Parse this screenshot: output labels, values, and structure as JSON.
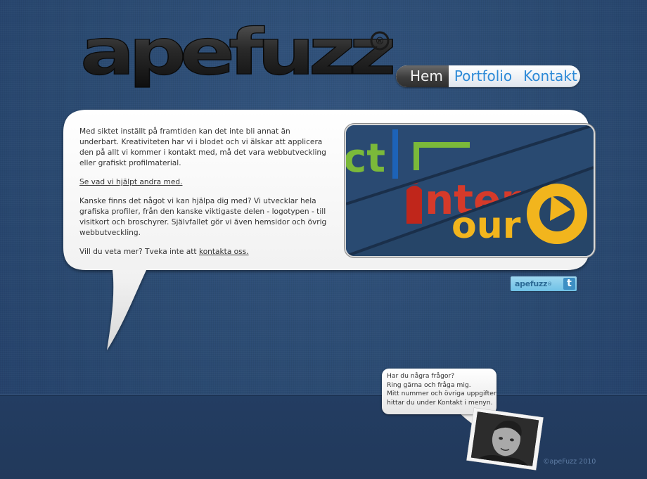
{
  "logo": {
    "text": "apefuzz",
    "mark": "®"
  },
  "nav": {
    "items": [
      "Hem",
      "Portfolio",
      "Kontakt"
    ],
    "active": "Hem"
  },
  "main": {
    "paragraph_1": "Med siktet inställt på framtiden kan det inte bli annat än underbart. Kreativiteten har vi i blodet och vi älskar att applicera den på allt vi kommer i kontakt med, må det vara webbutveckling eller grafiskt profilmaterial.",
    "link_see_help": "Se vad vi hjälpt andra med.",
    "paragraph_2": "Kanske finns det något vi kan hjälpa dig med? Vi utvecklar hela grafiska profiler, från den kanske viktigaste delen - logotypen - till visitkort och broschyrer. Självfallet gör vi även hemsidor och övrig webbutveckling.",
    "paragraph_3_prefix": "Vill du veta mer? Tveka inte att ",
    "link_contact": "kontakta oss."
  },
  "showcase": {
    "fragment_top": "ct",
    "fragment_middle": "nter",
    "fragment_bottom": "our"
  },
  "twitter_badge": {
    "text": "apefuzz",
    "mark": "®",
    "icon": "t"
  },
  "contact_bubble": {
    "line_1": "Har du några frågor?",
    "line_2": "Ring gärna och fråga mig.",
    "line_3": "Mitt nummer och övriga uppgifter",
    "line_4": "hittar du under Kontakt i menyn."
  },
  "footer": {
    "copyright": "©apeFuzz 2010"
  },
  "colors": {
    "background": "#2b4a73",
    "nav_link": "#2d8ad7",
    "nav_active": "#3d3d3d",
    "showcase_red": "#d63a2a",
    "showcase_yellow": "#f2b51d",
    "showcase_green": "#7bb93a"
  }
}
